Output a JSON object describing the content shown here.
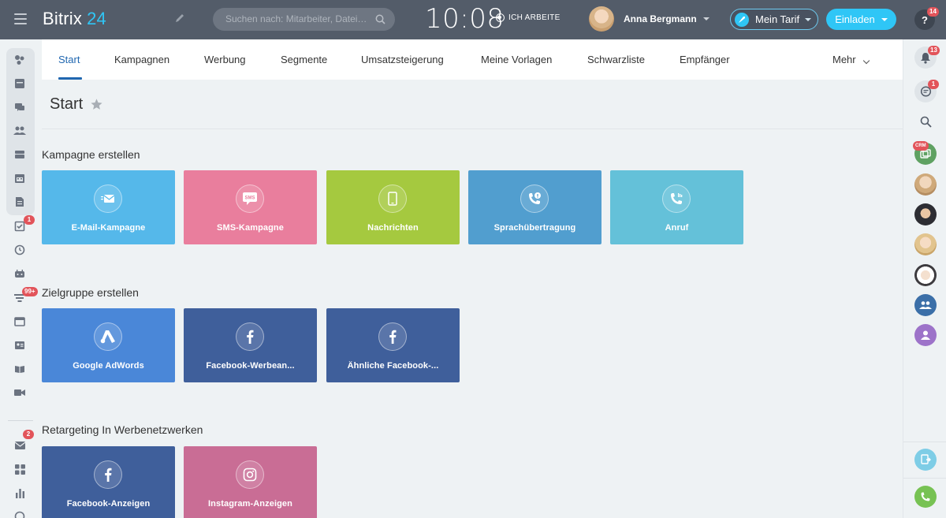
{
  "header": {
    "logo_text": "Bitrix",
    "logo_number": "24",
    "search_placeholder": "Suchen nach: Mitarbeiter, Datei…",
    "clock": "10:08",
    "work_status": "ICH ARBEITE",
    "user_name": "Anna Bergmann",
    "tarif_label": "Mein Tarif",
    "invite_label": "Einladen",
    "help_label": "?",
    "help_badge": "14"
  },
  "tabs": [
    {
      "label": "Start",
      "active": true
    },
    {
      "label": "Kampagnen"
    },
    {
      "label": "Werbung"
    },
    {
      "label": "Segmente"
    },
    {
      "label": "Umsatzsteigerung"
    },
    {
      "label": "Meine Vorlagen"
    },
    {
      "label": "Schwarzliste"
    },
    {
      "label": "Empfänger"
    },
    {
      "label": "Mehr"
    }
  ],
  "page": {
    "title": "Start"
  },
  "sections": [
    {
      "title": "Kampagne erstellen",
      "tiles": [
        {
          "label": "E-Mail-Kampagne",
          "color": "#55b8ea",
          "icon": "mail-icon"
        },
        {
          "label": "SMS-Kampagne",
          "color": "#e97e9d",
          "icon": "sms-icon"
        },
        {
          "label": "Nachrichten",
          "color": "#a5c93f",
          "icon": "smartphone-icon"
        },
        {
          "label": "Sprachübertragung",
          "color": "#519ecf",
          "icon": "phone-info-icon"
        },
        {
          "label": "Anruf",
          "color": "#64c1d9",
          "icon": "phone-call-icon"
        }
      ]
    },
    {
      "title": "Zielgruppe erstellen",
      "tiles": [
        {
          "label": "Google AdWords",
          "color": "#4a87d8",
          "icon": "adwords-icon"
        },
        {
          "label": "Facebook-Werbean...",
          "color": "#3f5f9b",
          "icon": "facebook-icon"
        },
        {
          "label": "Ähnliche Facebook-...",
          "color": "#3f5f9b",
          "icon": "facebook-icon"
        }
      ]
    },
    {
      "title": "Retargeting In Werbenetzwerken",
      "tiles": [
        {
          "label": "Facebook-Anzeigen",
          "color": "#3f5f9b",
          "icon": "facebook-icon"
        },
        {
          "label": "Instagram-Anzeigen",
          "color": "#c96d95",
          "icon": "instagram-icon"
        }
      ]
    }
  ],
  "left_sidebar": {
    "badges": {
      "tasks": "1",
      "filter": "99+",
      "mail": "2"
    }
  },
  "right_sidebar": {
    "notifications_badge": "13",
    "chat_badge": "1",
    "crm_label": "CRM"
  }
}
